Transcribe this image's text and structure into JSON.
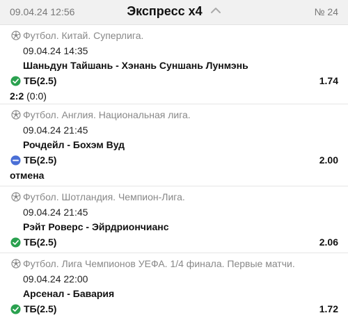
{
  "header": {
    "datetime": "09.04.24 12:56",
    "title": "Экспресс x4",
    "number": "№ 24"
  },
  "events": [
    {
      "league": "Футбол. Китай. Суперлига.",
      "datetime": "09.04.24 14:35",
      "teams": "Шаньдун Тайшань - Хэнань Суншань Лунмэнь",
      "bet": "ТБ(2.5)",
      "odds": "1.74",
      "status": "won",
      "score": "2:2",
      "score_half": "(0:0)"
    },
    {
      "league": "Футбол. Англия. Национальная лига.",
      "datetime": "09.04.24 21:45",
      "teams": "Рочдейл - Бохэм Вуд",
      "bet": "ТБ(2.5)",
      "odds": "2.00",
      "status": "cancelled",
      "result_text": "отмена"
    },
    {
      "league": "Футбол. Шотландия. Чемпион-Лига.",
      "datetime": "09.04.24 21:45",
      "teams": "Рэйт Роверс - Эйрдриончианс",
      "bet": "ТБ(2.5)",
      "odds": "2.06",
      "status": "won"
    },
    {
      "league": "Футбол. Лига Чемпионов УЕФА. 1/4 финала. Первые матчи.",
      "datetime": "09.04.24 22:00",
      "teams": "Арсенал - Бавария",
      "bet": "ТБ(2.5)",
      "odds": "1.72",
      "status": "won"
    }
  ],
  "colors": {
    "won": "#2aa14f",
    "cancelled": "#4a6fd6",
    "muted": "#888888"
  },
  "icons": {
    "league": "soccer-ball-icon",
    "won": "check-circle-icon",
    "cancelled": "minus-circle-icon",
    "collapse": "chevron-up-icon"
  }
}
